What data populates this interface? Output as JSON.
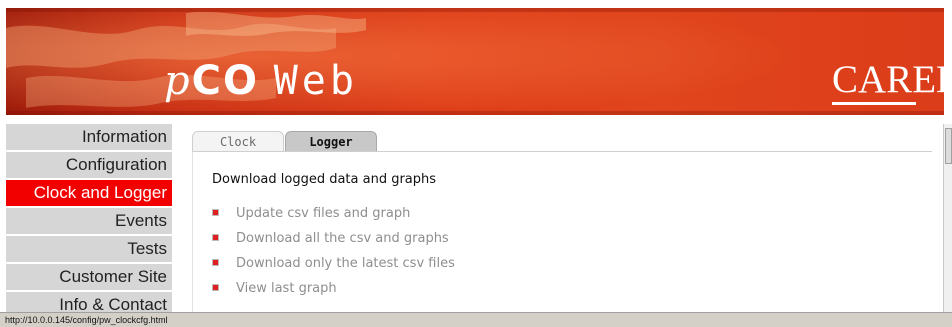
{
  "banner": {
    "brand_p": "p",
    "brand_co": "CO",
    "brand_web": "Web",
    "carel_logo": "CAREL"
  },
  "sidebar": {
    "items": [
      {
        "label": "Information",
        "active": false
      },
      {
        "label": "Configuration",
        "active": false
      },
      {
        "label": "Clock and Logger",
        "active": true
      },
      {
        "label": "Events",
        "active": false
      },
      {
        "label": "Tests",
        "active": false
      },
      {
        "label": "Customer Site",
        "active": false
      },
      {
        "label": "Info & Contact",
        "active": false
      }
    ]
  },
  "tabs": {
    "clock": "Clock",
    "logger": "Logger",
    "selected": "Logger"
  },
  "main": {
    "heading": "Download logged data and graphs",
    "links": [
      "Update csv files and graph",
      "Download all the csv and graphs",
      "Download only the latest csv files",
      "View last graph"
    ]
  },
  "status_bar": {
    "text": "http://10.0.0.145/config/pw_clockcfg.html"
  },
  "colors": {
    "banner_red": "#dd3b17",
    "active_nav": "#f20000",
    "bullet": "#e02020"
  }
}
